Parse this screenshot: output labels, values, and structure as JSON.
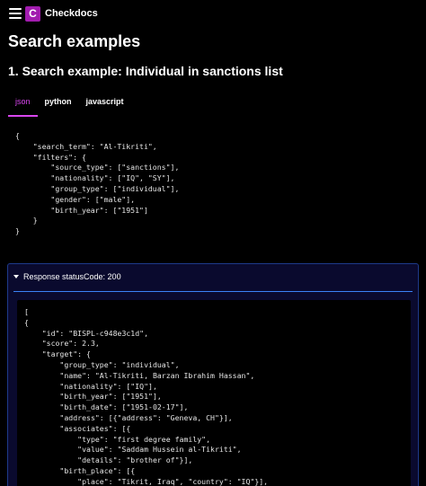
{
  "app": {
    "name": "Checkdocs",
    "logo_letter": "C"
  },
  "page": {
    "title": "Search examples",
    "section_title": "1. Search example: Individual in sanctions list"
  },
  "tabs": [
    {
      "label": "json"
    },
    {
      "label": "python"
    },
    {
      "label": "javascript"
    }
  ],
  "request_code": [
    "{",
    "    \"search_term\": \"Al-Tikriti\",",
    "    \"filters\": {",
    "        \"source_type\": [\"sanctions\"],",
    "        \"nationality\": [\"IQ\", \"SY\"],",
    "        \"group_type\": [\"individual\"],",
    "        \"gender\": [\"male\"],",
    "        \"birth_year\": [\"1951\"]",
    "    }",
    "}"
  ],
  "response": {
    "label": "Response statusCode: 200",
    "code": [
      "[",
      "{",
      "    \"id\": \"BISPL-c948e3c1d\",",
      "    \"score\": 2.3,",
      "    \"target\": {",
      "        \"group_type\": \"individual\",",
      "        \"name\": \"Al-Tikriti, Barzan Ibrahim Hassan\",",
      "        \"nationality\": [\"IQ\"],",
      "        \"birth_year\": [\"1951\"],",
      "        \"birth_date\": [\"1951-02-17\"],",
      "        \"address\": [{\"address\": \"Geneva, CH\"}],",
      "        \"associates\": [{",
      "            \"type\": \"first degree family\",",
      "            \"value\": \"Saddam Hussein al-Tikriti\",",
      "            \"details\": \"brother of\"}],",
      "        \"birth_place\": [{",
      "            \"place\": \"Tikrit, Iraq\", \"country\": \"IQ\"}],"
    ]
  }
}
